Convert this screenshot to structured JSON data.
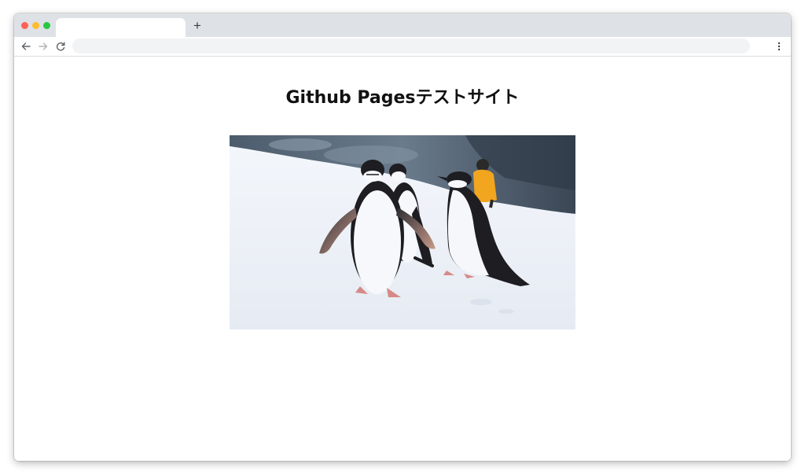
{
  "browser": {
    "tab": {
      "title": ""
    },
    "new_tab_label": "+",
    "address_bar": {
      "value": "",
      "placeholder": ""
    },
    "controls": {
      "back_icon": "arrow-left-icon",
      "forward_icon": "arrow-right-icon",
      "reload_icon": "reload-icon",
      "menu_icon": "kebab-menu-icon"
    },
    "colors": {
      "tabstrip": "#dee1e6",
      "close": "#ff5f57",
      "minimize": "#febc2e",
      "maximize": "#28c840"
    }
  },
  "page": {
    "title": "Github Pagesテストサイト",
    "image": {
      "subject": "penguins on snow"
    }
  }
}
